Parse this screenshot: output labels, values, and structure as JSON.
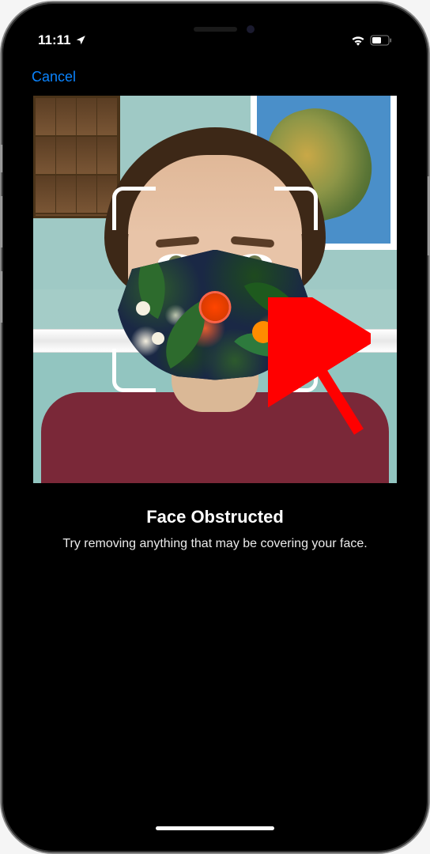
{
  "status_bar": {
    "time": "11:11",
    "location_active": true,
    "wifi_active": true,
    "battery_level": "half"
  },
  "nav": {
    "cancel_label": "Cancel"
  },
  "message": {
    "title": "Face Obstructed",
    "subtitle": "Try removing anything that may be covering your face."
  },
  "colors": {
    "accent": "#0a84ff",
    "annotation_arrow": "#ff0000"
  }
}
